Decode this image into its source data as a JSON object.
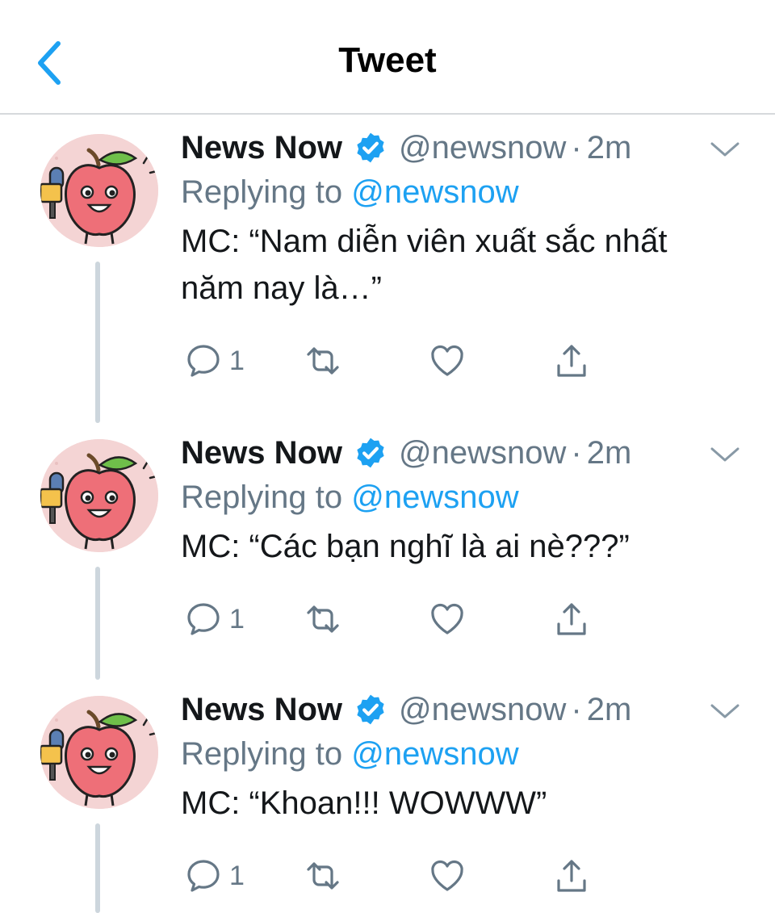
{
  "nav": {
    "title": "Tweet",
    "back_icon": "chevron-left-icon"
  },
  "colors": {
    "accent": "#1da1f2",
    "muted": "#657786",
    "text": "#14171a",
    "divider": "#d6d9dc",
    "thread_line": "#cdd6dd",
    "avatar_bg": "#f4d4d4"
  },
  "tweets": [
    {
      "name": "News Now",
      "verified": true,
      "handle": "@newsnow",
      "dot": "·",
      "time": "2m",
      "replying_prefix": "Replying to",
      "replying_handle": "@newsnow",
      "text": "MC: “Nam diễn viên xuất sắc nhất năm nay là…”",
      "reply_count": "1"
    },
    {
      "name": "News Now",
      "verified": true,
      "handle": "@newsnow",
      "dot": "·",
      "time": "2m",
      "replying_prefix": "Replying to",
      "replying_handle": "@newsnow",
      "text": "MC: “Các bạn nghĩ là ai nè???”",
      "reply_count": "1"
    },
    {
      "name": "News Now",
      "verified": true,
      "handle": "@newsnow",
      "dot": "·",
      "time": "2m",
      "replying_prefix": "Replying to",
      "replying_handle": "@newsnow",
      "text": "MC: “Khoan!!! WOWWW”",
      "reply_count": "1"
    }
  ]
}
